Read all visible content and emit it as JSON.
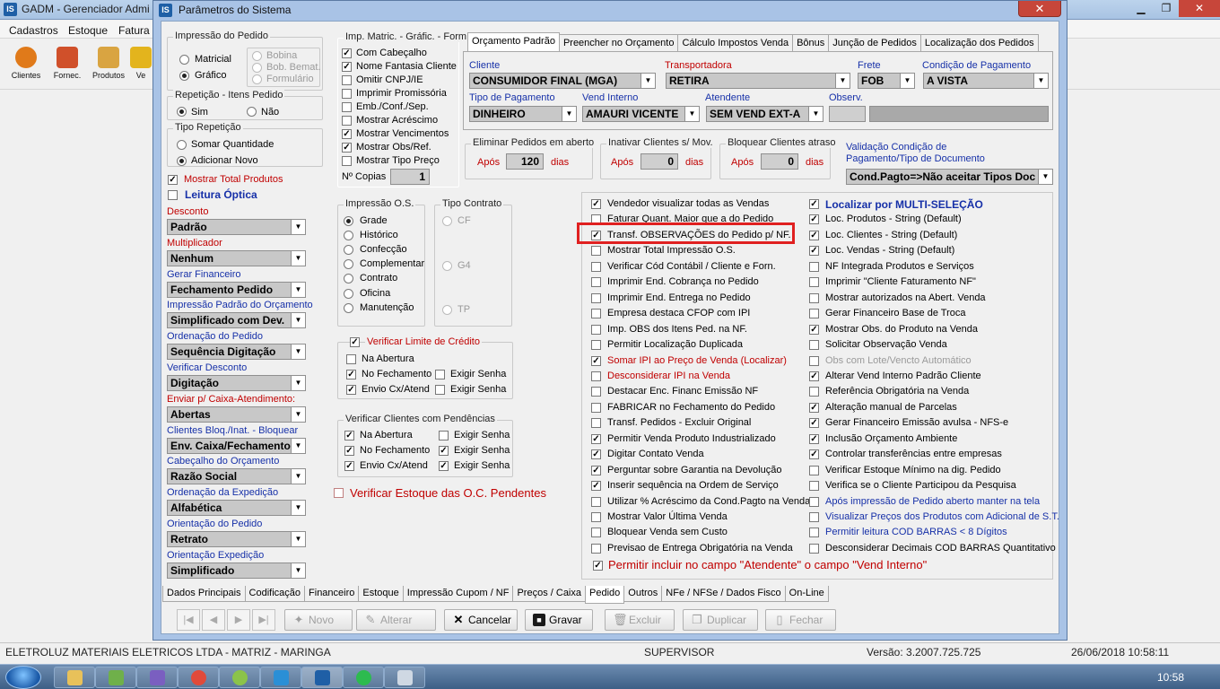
{
  "app": {
    "title": "GADM - Gerenciador Admi",
    "menu": [
      "Cadastros",
      "Estoque",
      "Fatura"
    ],
    "toolbar": [
      "Clientes",
      "Fornec.",
      "Produtos",
      "Ve"
    ],
    "status": {
      "company": "ELETROLUZ MATERIAIS ELETRICOS LTDA  -  MATRIZ - MARINGA",
      "user": "SUPERVISOR",
      "version": "Versão: 3.2007.725.725",
      "datetime": "26/06/2018 10:58:11"
    },
    "clock": "10:58"
  },
  "dialog": {
    "title": "Parâmetros do Sistema",
    "close": "✕",
    "impressao_pedido": {
      "legend": "Impressão do Pedido",
      "options": [
        "Matricial",
        "Gráfico"
      ],
      "selected": "Gráfico",
      "bobina": [
        "Bobina",
        "Bob. Bemat.",
        "Formulário"
      ]
    },
    "repeticao": {
      "legend": "Repetição - Itens Pedido",
      "options": [
        "Sim",
        "Não"
      ],
      "selected": "Sim"
    },
    "tipo_repeticao": {
      "legend": "Tipo Repetição",
      "options": [
        "Somar Quantidade",
        "Adicionar Novo"
      ],
      "selected": "Adicionar Novo"
    },
    "mostrar_total_produtos": "Mostrar Total Produtos",
    "leitura_optica": "Leitura Óptica",
    "left_combos": [
      {
        "label": "Desconto",
        "value": "Padrão",
        "color": "red"
      },
      {
        "label": "Multiplicador",
        "value": "Nenhum",
        "color": "red"
      },
      {
        "label": "Gerar Financeiro",
        "value": "Fechamento Pedido",
        "color": "blue"
      },
      {
        "label": "Impressão Padrão do Orçamento",
        "value": "Simplificado com Dev.",
        "color": "blue"
      },
      {
        "label": "Ordenação do Pedido",
        "value": "Sequência Digitação",
        "color": "blue"
      },
      {
        "label": "Verificar Desconto",
        "value": "Digitação",
        "color": "blue"
      },
      {
        "label": "Enviar p/ Caixa-Atendimento:",
        "value": "Abertas",
        "color": "red"
      },
      {
        "label": "Clientes Bloq./Inat. - Bloquear",
        "value": "Env. Caixa/Fechamento",
        "color": "blue"
      },
      {
        "label": "Cabeçalho do Orçamento",
        "value": "Razão Social",
        "color": "blue"
      },
      {
        "label": "Ordenação da Expedição",
        "value": "Alfabética",
        "color": "blue"
      },
      {
        "label": "Orientação do Pedido",
        "value": "Retrato",
        "color": "blue"
      },
      {
        "label": "Orientação Expedição",
        "value": "Simplificado",
        "color": "blue"
      }
    ],
    "imp_matric": {
      "legend": "Imp. Matric. - Gráfic. - Form.",
      "items": [
        {
          "label": "Com Cabeçalho",
          "checked": true
        },
        {
          "label": "Nome Fantasia Cliente",
          "checked": true
        },
        {
          "label": "Omitir CNPJ/IE",
          "checked": false
        },
        {
          "label": "Imprimir Promissória",
          "checked": false
        },
        {
          "label": "Emb./Conf./Sep.",
          "checked": false
        },
        {
          "label": "Mostrar Acréscimo",
          "checked": false
        },
        {
          "label": "Mostrar Vencimentos",
          "checked": true
        },
        {
          "label": "Mostrar Obs/Ref.",
          "checked": true
        },
        {
          "label": "Mostrar Tipo Preço",
          "checked": false
        }
      ],
      "copias_label": "Nº Copias",
      "copias": "1"
    },
    "impressao_os": {
      "legend": "Impressão O.S.",
      "options": [
        "Grade",
        "Histórico",
        "Confecção",
        "Complementar",
        "Contrato",
        "Oficina",
        "Manutenção"
      ],
      "selected": "Grade"
    },
    "tipo_contrato": {
      "legend": "Tipo Contrato",
      "options": [
        "CF",
        "G4",
        "TP"
      ]
    },
    "limite_credito": {
      "legend": "Verificar Limite de Crédito",
      "items": [
        {
          "label": "Na Abertura",
          "checked": false
        },
        {
          "label": "No Fechamento",
          "checked": true
        },
        {
          "label": "Exigir Senha",
          "checked": false
        },
        {
          "label": "Envio Cx/Atend",
          "checked": true
        },
        {
          "label": "Exigir Senha",
          "checked": false
        }
      ]
    },
    "pendencias": {
      "legend": "Verificar Clientes com Pendências",
      "items": [
        {
          "label": "Na Abertura",
          "checked": true
        },
        {
          "label": "Exigir Senha",
          "checked": false
        },
        {
          "label": "No Fechamento",
          "checked": true
        },
        {
          "label": "Exigir Senha",
          "checked": true
        },
        {
          "label": "Envio Cx/Atend",
          "checked": true
        },
        {
          "label": "Exigir Senha",
          "checked": true
        }
      ]
    },
    "verificar_estoque_oc": "Verificar Estoque das O.C. Pendentes",
    "top_tabs": [
      "Orçamento Padrão",
      "Preencher no Orçamento",
      "Cálculo Impostos Venda",
      "Bônus",
      "Junção de Pedidos",
      "Localização dos Pedidos"
    ],
    "orcamento": {
      "cliente_label": "Cliente",
      "cliente": "CONSUMIDOR FINAL (MGA)",
      "transportadora_label": "Transportadora",
      "transportadora": "RETIRA",
      "frete_label": "Frete",
      "frete": "FOB",
      "condicao_label": "Condição de Pagamento",
      "condicao": "A VISTA",
      "tipo_pag_label": "Tipo de Pagamento",
      "tipo_pag": "DINHEIRO",
      "vend_interno_label": "Vend Interno",
      "vend_interno": "AMAURI VICENTE",
      "atendente_label": "Atendente",
      "atendente": "SEM VEND EXT-A",
      "observ_label": "Observ."
    },
    "eliminar": {
      "legend": "Eliminar Pedidos em aberto",
      "apos": "Após",
      "value": "120",
      "dias": "dias"
    },
    "inativar": {
      "legend": "Inativar Clientes s/ Mov.",
      "apos": "Após",
      "value": "0",
      "dias": "dias"
    },
    "bloquear": {
      "legend": "Bloquear Clientes atraso",
      "apos": "Após",
      "value": "0",
      "dias": "dias"
    },
    "validacao": {
      "label1": "Validação Condição de",
      "label2": "Pagamento/Tipo de Documento",
      "value": "Cond.Pagto=>Não aceitar Tipos Doc"
    },
    "options_left": [
      {
        "label": "Vendedor visualizar todas as Vendas",
        "checked": true,
        "color": "black"
      },
      {
        "label": "Faturar Quant. Maior que a do Pedido",
        "checked": false,
        "color": "black"
      },
      {
        "label": "Transf. OBSERVAÇÕES do Pedido p/ NF.",
        "checked": true,
        "color": "black"
      },
      {
        "label": "Mostrar Total Impressão O.S.",
        "checked": false,
        "color": "black"
      },
      {
        "label": "Verificar Cód Contábil / Cliente e Forn.",
        "checked": false,
        "color": "black"
      },
      {
        "label": "Imprimir End. Cobrança no Pedido",
        "checked": false,
        "color": "black"
      },
      {
        "label": "Imprimir End. Entrega no Pedido",
        "checked": false,
        "color": "black"
      },
      {
        "label": "Empresa destaca CFOP com IPI",
        "checked": false,
        "color": "black"
      },
      {
        "label": "Imp. OBS dos Itens Ped. na NF.",
        "checked": false,
        "color": "black"
      },
      {
        "label": "Permitir Localização Duplicada",
        "checked": false,
        "color": "black"
      },
      {
        "label": "Somar IPI ao Preço de Venda (Localizar)",
        "checked": true,
        "color": "red"
      },
      {
        "label": "Desconsiderar IPI na Venda",
        "checked": false,
        "color": "red"
      },
      {
        "label": "Destacar Enc. Financ Emissão NF",
        "checked": false,
        "color": "black"
      },
      {
        "label": "FABRICAR no Fechamento do Pedido",
        "checked": false,
        "color": "black"
      },
      {
        "label": "Transf. Pedidos - Excluir Original",
        "checked": false,
        "color": "black"
      },
      {
        "label": "Permitir Venda Produto Industrializado",
        "checked": true,
        "color": "black"
      },
      {
        "label": "Digitar Contato Venda",
        "checked": true,
        "color": "black"
      },
      {
        "label": "Perguntar sobre Garantia na Devolução",
        "checked": true,
        "color": "black"
      },
      {
        "label": "Inserir sequência na Ordem de Serviço",
        "checked": true,
        "color": "black"
      },
      {
        "label": "Utilizar % Acréscimo da Cond.Pagto na Venda",
        "checked": false,
        "color": "black"
      },
      {
        "label": "Mostrar Valor Última Venda",
        "checked": false,
        "color": "black"
      },
      {
        "label": "Bloquear Venda sem Custo",
        "checked": false,
        "color": "black"
      },
      {
        "label": "Previsao de Entrega Obrigatória na Venda",
        "checked": false,
        "color": "black"
      }
    ],
    "options_right": [
      {
        "label": "Localizar por MULTI-SELEÇÃO",
        "checked": true,
        "color": "blue-bold"
      },
      {
        "label": "Loc. Produtos - String (Default)",
        "checked": true,
        "color": "black"
      },
      {
        "label": "Loc. Clientes - String (Default)",
        "checked": true,
        "color": "black"
      },
      {
        "label": "Loc. Vendas - String (Default)",
        "checked": true,
        "color": "black"
      },
      {
        "label": "NF Integrada Produtos e Serviços",
        "checked": false,
        "color": "black"
      },
      {
        "label": "Imprimir \"Cliente Faturamento NF\"",
        "checked": false,
        "color": "black"
      },
      {
        "label": "Mostrar autorizados na Abert. Venda",
        "checked": false,
        "color": "black"
      },
      {
        "label": "Gerar Financeiro Base de Troca",
        "checked": false,
        "color": "black"
      },
      {
        "label": "Mostrar Obs. do Produto na Venda",
        "checked": true,
        "color": "black"
      },
      {
        "label": "Solicitar Observação Venda",
        "checked": false,
        "color": "black"
      },
      {
        "label": "Obs com Lote/Vencto Automático",
        "checked": false,
        "color": "gray"
      },
      {
        "label": "Alterar Vend Interno Padrão Cliente",
        "checked": true,
        "color": "black"
      },
      {
        "label": "Referência Obrigatória na Venda",
        "checked": false,
        "color": "black"
      },
      {
        "label": "Alteração manual de Parcelas",
        "checked": true,
        "color": "black"
      },
      {
        "label": "Gerar Financeiro Emissão avulsa - NFS-e",
        "checked": true,
        "color": "black"
      },
      {
        "label": "Inclusão Orçamento Ambiente",
        "checked": true,
        "color": "black"
      },
      {
        "label": "Controlar transferências entre empresas",
        "checked": true,
        "color": "black"
      },
      {
        "label": "Verificar Estoque Mínimo na dig. Pedido",
        "checked": false,
        "color": "black"
      },
      {
        "label": "Verifica se o Cliente Participou da Pesquisa",
        "checked": false,
        "color": "black"
      },
      {
        "label": "Após impressão de Pedido aberto manter na tela",
        "checked": false,
        "color": "blue"
      },
      {
        "label": "Visualizar Preços dos Produtos com Adicional de S.T.",
        "checked": false,
        "color": "blue"
      },
      {
        "label": "Permitir leitura COD BARRAS < 8 Dígitos",
        "checked": false,
        "color": "blue"
      },
      {
        "label": "Desconsiderar Decimais COD BARRAS Quantitativo",
        "checked": false,
        "color": "black"
      }
    ],
    "permitir_atendente": "Permitir incluir no campo \"Atendente\" o campo \"Vend Interno\"",
    "bottom_tabs": [
      "Dados Principais",
      "Codificação",
      "Financeiro",
      "Estoque",
      "Impressão Cupom / NF",
      "Preços / Caixa",
      "Pedido",
      "Outros",
      "NFe / NFSe / Dados Fisco",
      "On-Line"
    ],
    "active_bottom_tab": "Pedido",
    "nav": [
      "|◀",
      "◀",
      "▶",
      "▶|"
    ],
    "buttons": {
      "novo": "Novo",
      "alterar": "Alterar",
      "cancelar": "Cancelar",
      "gravar": "Gravar",
      "excluir": "Excluir",
      "duplicar": "Duplicar",
      "fechar": "Fechar"
    }
  },
  "colors": {
    "label_blue": "#1630a8",
    "label_red": "#c00000",
    "highlight": "#e02020"
  }
}
